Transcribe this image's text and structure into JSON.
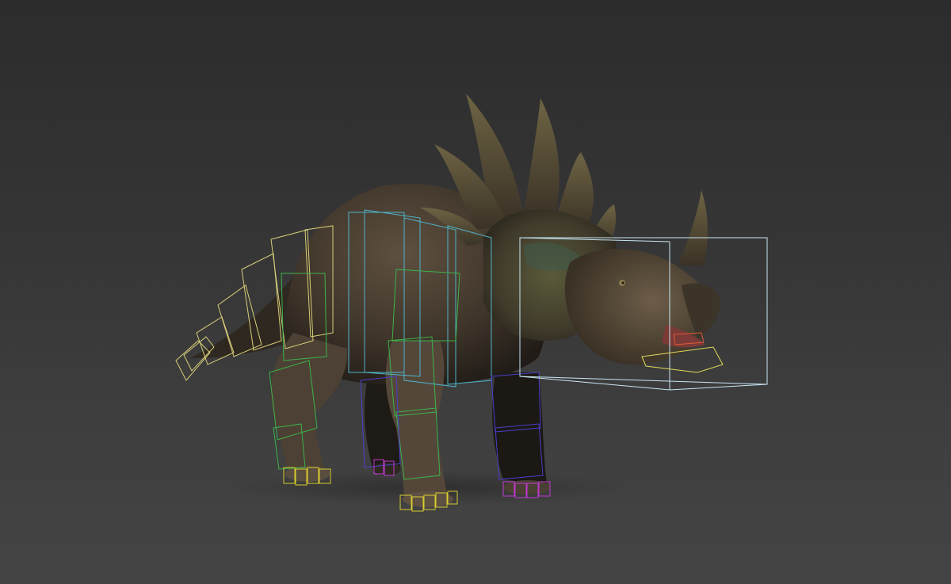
{
  "viewport": {
    "background_top": "#2c2c2c",
    "background_bottom": "#444444"
  },
  "model": {
    "subject": "styracosaurus-model",
    "skin_color": "#4a3f33",
    "skin_highlight": "#6b5a47",
    "horn_color": "#5c5036",
    "frill_accent": "#3f4a30"
  },
  "rig": {
    "colors": {
      "tail_bones": "#d8cf7a",
      "spine_bones": "#4fb3c9",
      "front_leg_bones": "#3db34a",
      "rear_leg_bones": "#3db34a",
      "right_leg_bones": "#4a3fd0",
      "feet_left": "#d8cc2e",
      "feet_right": "#c03ad0",
      "head_bounding_box": "#c8e6f5",
      "jaw_bone": "#e0d85a",
      "tongue_bone": "#e05a3a"
    }
  }
}
